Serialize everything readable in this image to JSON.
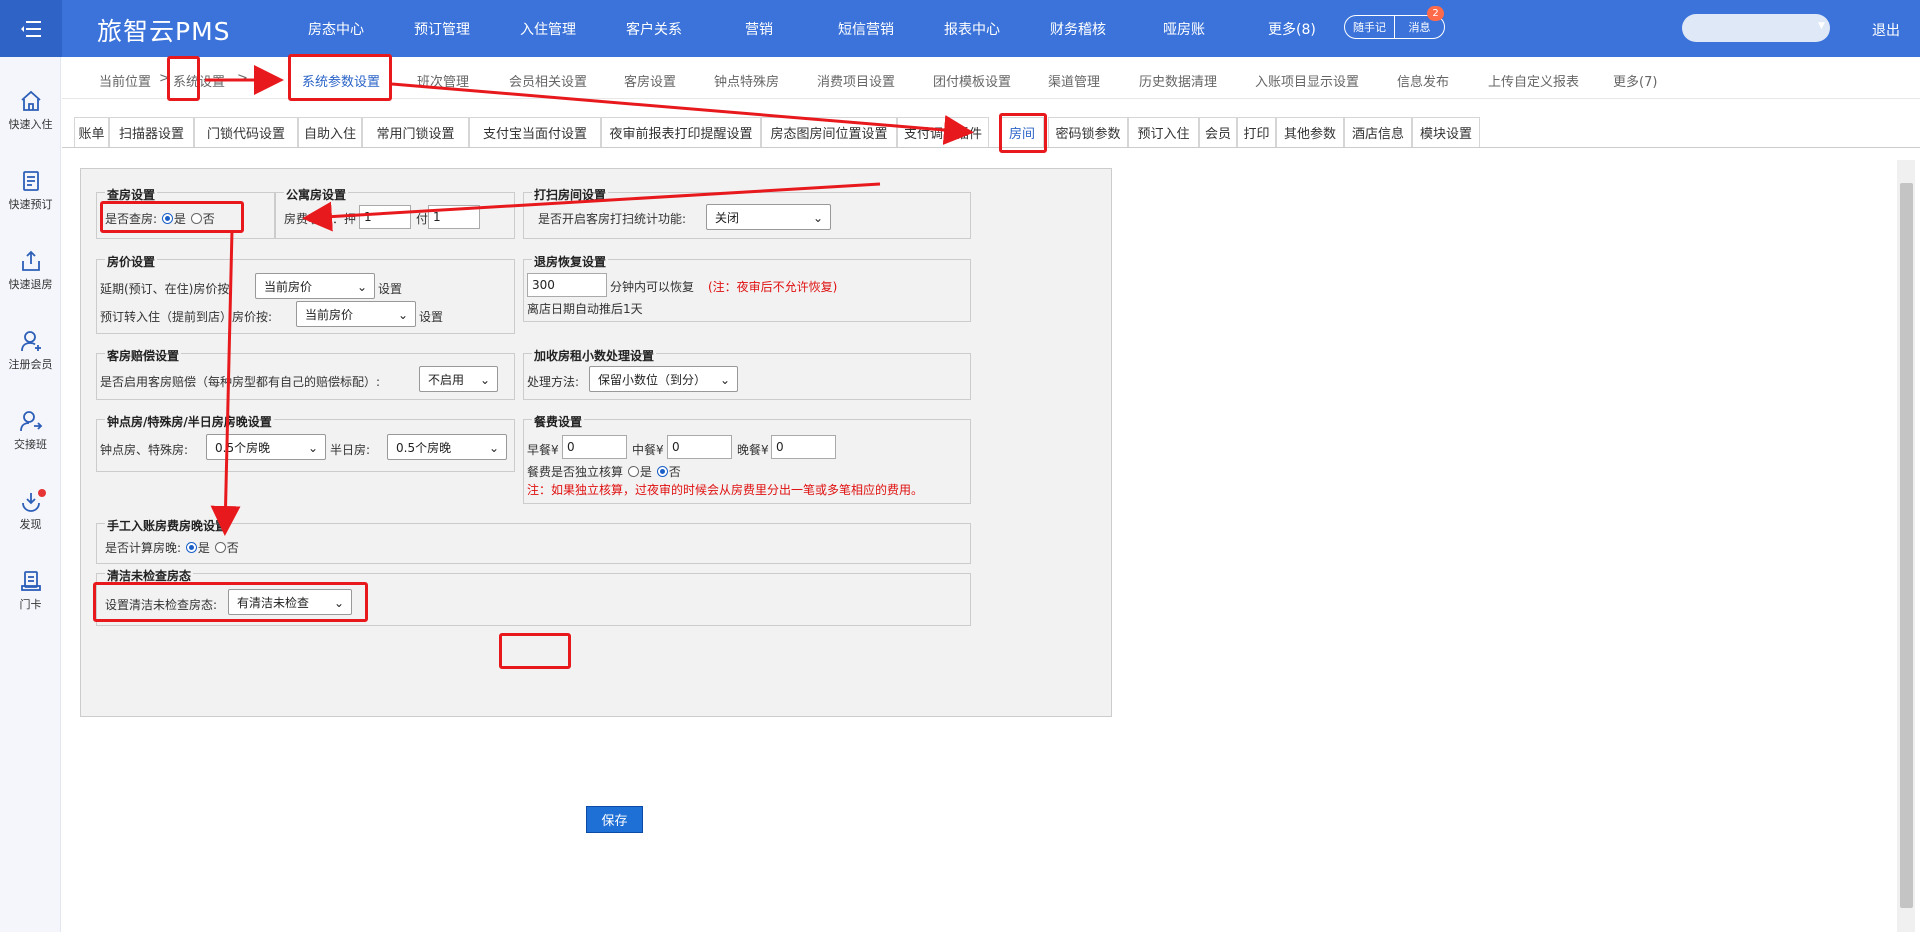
{
  "header": {
    "brand": "旅智云PMS",
    "nav": [
      "房态中心",
      "预订管理",
      "入住管理",
      "客户关系",
      "营销",
      "短信营销",
      "报表中心",
      "财务稽核",
      "哑房账",
      "更多(8)"
    ],
    "note_btn": "随手记",
    "msg_btn": "消息",
    "msg_count": "2",
    "logout": "退出"
  },
  "sidebar": [
    {
      "label": "快速入住",
      "icon": "home-icon"
    },
    {
      "label": "快速预订",
      "icon": "document-icon"
    },
    {
      "label": "快速退房",
      "icon": "checkout-icon"
    },
    {
      "label": "注册会员",
      "icon": "add-user-icon"
    },
    {
      "label": "交接班",
      "icon": "shift-icon"
    },
    {
      "label": "发现",
      "icon": "discover-icon"
    },
    {
      "label": "门卡",
      "icon": "card-icon"
    }
  ],
  "breadcrumb": {
    "prefix": "当前位置",
    "sep": ">",
    "section": "系统设置",
    "items": [
      "系统参数设置",
      "班次管理",
      "会员相关设置",
      "客房设置",
      "钟点特殊房",
      "消费项目设置",
      "团付模板设置",
      "渠道管理",
      "历史数据清理",
      "入账项目显示设置",
      "信息发布",
      "上传自定义报表",
      "更多(7)"
    ]
  },
  "subtabs": [
    "账单",
    "扫描器设置",
    "门锁代码设置",
    "自助入住",
    "常用门锁设置",
    "支付宝当面付设置",
    "夜审前报表打印提醒设置",
    "房态图房间位置设置",
    "支付调用插件",
    "房间",
    "密码锁参数",
    "预订入住",
    "会员",
    "打印",
    "其他参数",
    "酒店信息",
    "模块设置"
  ],
  "form": {
    "check_room": {
      "title": "查房设置",
      "label": "是否查房:",
      "yes": "是",
      "no": "否"
    },
    "apartment": {
      "title": "公寓房设置",
      "label": "房费收取：押",
      "deposit": "1",
      "pay_label": "付",
      "pay": "1"
    },
    "cleaning": {
      "title": "打扫房间设置",
      "label": "是否开启客房打扫统计功能:",
      "value": "关闭"
    },
    "room_price": {
      "title": "房价设置",
      "row1_label": "延期(预订、在住)房价按:",
      "row1_value": "当前房价",
      "row1_suffix": "设置",
      "row2_label": "预订转入住（提前到店）房价按:",
      "row2_value": "当前房价",
      "row2_suffix": "设置"
    },
    "checkout_restore": {
      "title": "退房恢复设置",
      "minutes": "300",
      "label": "分钟内可以恢复",
      "note": "(注：夜审后不允许恢复)",
      "auto_note": "离店日期自动推后1天"
    },
    "compensation": {
      "title": "客房赔偿设置",
      "label": "是否启用客房赔偿（每种房型都有自己的赔偿标配）:",
      "value": "不启用"
    },
    "rent_decimal": {
      "title": "加收房租小数处理设置",
      "label": "处理方法:",
      "value": "保留小数位（到分）"
    },
    "hourly": {
      "title": "钟点房/特殊房/半日房房晚设置",
      "label1": "钟点房、特殊房:",
      "value1": "0.5个房晚",
      "label2": "半日房:",
      "value2": "0.5个房晚"
    },
    "meal": {
      "title": "餐费设置",
      "breakfast_label": "早餐¥",
      "breakfast": "0",
      "lunch_label": "中餐¥",
      "lunch": "0",
      "dinner_label": "晚餐¥",
      "dinner": "0",
      "independent_label": "餐费是否独立核算",
      "yes": "是",
      "no": "否",
      "note": "注：如果独立核算，过夜审的时候会从房费里分出一笔或多笔相应的费用。"
    },
    "manual": {
      "title": "手工入账房费房晚设置",
      "label": "是否计算房晚:",
      "yes": "是",
      "no": "否"
    },
    "clean_uncheck": {
      "title": "清洁未检查房态",
      "label": "设置清洁未检查房态:",
      "value": "有清洁未检查"
    },
    "save": "保存"
  }
}
